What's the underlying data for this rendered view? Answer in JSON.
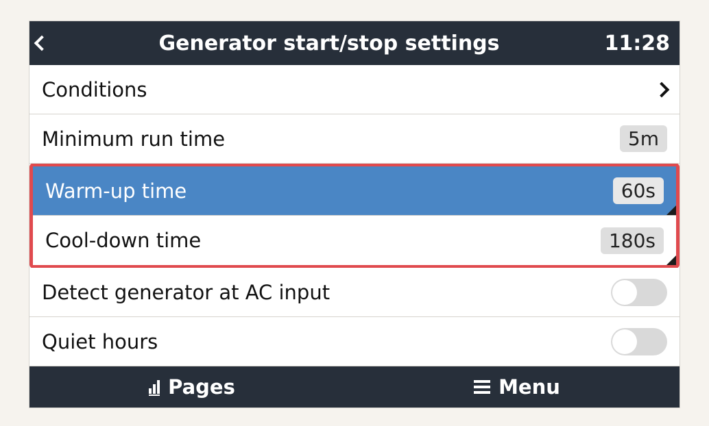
{
  "header": {
    "title": "Generator start/stop settings",
    "clock": "11:28"
  },
  "rows": {
    "conditions": {
      "label": "Conditions"
    },
    "min_run_time": {
      "label": "Minimum run time",
      "value": "5m"
    },
    "warm_up_time": {
      "label": "Warm-up time",
      "value": "60s"
    },
    "cool_down_time": {
      "label": "Cool-down time",
      "value": "180s"
    },
    "detect_generator": {
      "label": "Detect generator at AC input",
      "on": false
    },
    "quiet_hours": {
      "label": "Quiet hours",
      "on": false
    }
  },
  "footer": {
    "pages": "Pages",
    "menu": "Menu"
  }
}
